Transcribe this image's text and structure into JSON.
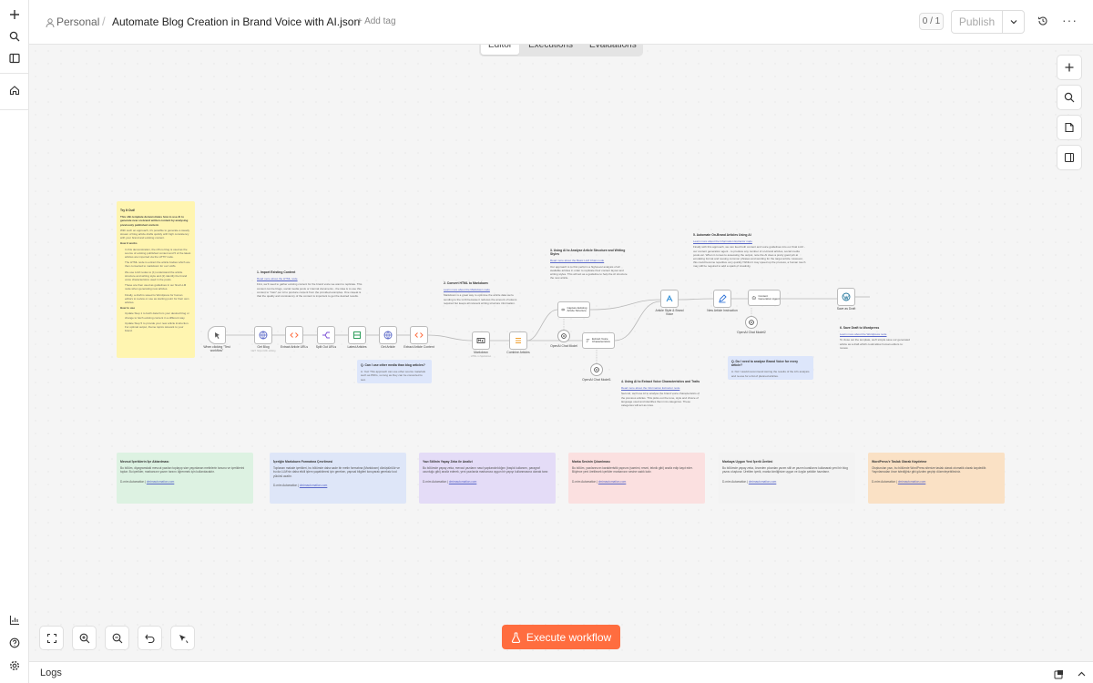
{
  "header": {
    "breadcrumb_owner": "Personal",
    "workflow_title": "Automate Blog Creation in Brand Voice with AI.json",
    "add_tag": "+ Add tag",
    "version_counter": "0 / 1",
    "publish_label": "Publish"
  },
  "tabs": [
    {
      "label": "Editor",
      "active": true
    },
    {
      "label": "Executions",
      "active": false
    },
    {
      "label": "Evaluations",
      "active": false
    }
  ],
  "sticky_notes": {
    "try_it": {
      "title": "Try It Out!",
      "lines": [
        "This n8n template demonstrates how to use AI to generate new on-brand written content by analysing previously published content.",
        "With such an approach, it's possible to generate a steady stream of blog article drafts quickly with high consistency with your brand and existing content.",
        "How it works",
        "In this demonstration, the n8n.io blog is used as the source of existing published content and 5 of the latest articles are imported via the HTTP node.",
        "The HTML node is extract the article bodies which are then converted to markdown for our LLMs.",
        "We use LLM nodes to (1) understand the article structure and writing style and (2) identify the brand voice characteristics used in the posts.",
        "These are then used as guidelines in our final LLM node when generating new articles.",
        "Finally, a draft is saved to Wordpress for human editors to review or use as starting point for their own articles.",
        "How to use",
        "Update Step 1 to fetch data from your desired blog or change to fetch existing content in a different way.",
        "Update Step 5 to provide your new article instruction. For optimal output, theme topics relevant to your brand."
      ]
    },
    "step1": {
      "title": "1. Import Existing Content",
      "link": "Read more about the HTML node",
      "body": "First, we'll need to gather existing content for the brand voice we want to replicate. This content can be blogs, social media posts or internal documents - the idea is to use this content to \"train\" our AI to produce content from the provided examples. One caveat is that the quality and consistency of the content is important to get the desired results."
    },
    "step2": {
      "title": "2. Convert HTML to Markdown",
      "link": "Learn more about the Markdown node",
      "body": "Markdown is a great way to optimise the article data we're sending to the LLM because it reduces the amount of tokens required but keeps all relevant writing structure information."
    },
    "step3": {
      "title": "3. Using AI to Analyse Article Structure and Writing Styles",
      "link": "Read more about the Basic LLM Chain node",
      "body": "Our approach is to first perform a high-level analysis of all available articles in order to replicate their content layout and writing styles. This will act as a guideline to help the AI structure the new article."
    },
    "step4": {
      "title": "4. Using AI to Extract Voice Characteristics and Traits",
      "link": "Read more about the Information Extractor node",
      "body": "Second, we'll use AI to analyse the brand voice characteristics of the previous articles. This picks out the tone, style and choice of language used and identifies them into categories. These categories will act as rules."
    },
    "step5": {
      "title": "5. Automate On-Brand Articles Using AI",
      "link": "Learn more about the Information Extractor node",
      "body": "Finally with this approach, we can feed both content and voice guidelines into our final LLM - our content generation agent - to produce any number of on-brand articles, social media posts etc. When it comes to assessing the output, note the AI does a pretty good job at emulating format and reusing common phrases and wording for the target article. However, this could become repetitive very quickly! Whilst it may speed up the process, a human touch may still be required to add a spark of creativity."
    },
    "step6": {
      "title": "6. Save Draft to Wordpress",
      "link": "Learn more about the Wordpress node",
      "body": "To close out the template, we'll simple save our generated article as a draft which could allow human editors to review."
    },
    "q1": {
      "title": "Q. Can I use other media than blog articles?",
      "body": "A. Yes! This approach can use other source materials such as PDFs, so long as they can be converted to text."
    },
    "q2": {
      "title": "Q. Do I need to analyse Brand Voice for every article?",
      "body": "A. No! I would recommend storing the results of the AI's analysis and re-use for a list of planned articles."
    }
  },
  "nodes": {
    "trigger": {
      "label": "When clicking \"Test workflow\""
    },
    "get_blog": {
      "label": "Get Blog",
      "sub": "GET: https://n8n.io/blog"
    },
    "extract_urls": {
      "label": "Extract Article URLs",
      "sub": "..."
    },
    "split_urls": {
      "label": "Split Out URLs"
    },
    "latest": {
      "label": "Latest Articles"
    },
    "get_article": {
      "label": "Get Article"
    },
    "extract_content": {
      "label": "Extract Article Content",
      "sub": "..."
    },
    "markdown": {
      "label": "Markdown",
      "sub": "HTML to Markdown"
    },
    "combine": {
      "label": "Combine Articles"
    },
    "capture_structure": {
      "label": "Capture Existing Article Structure"
    },
    "extract_voice": {
      "label": "Extract Voice Characteristics"
    },
    "model_a": {
      "label": "OpenAI Chat Model"
    },
    "model_b": {
      "label": "OpenAI Chat Model1"
    },
    "style_voice": {
      "label": "Article Style & Brand Voice"
    },
    "new_instruction": {
      "label": "New Article Instruction"
    },
    "content_gen": {
      "label": "Content Generation Agent"
    },
    "model_c": {
      "label": "OpenAI Chat Model2"
    },
    "save_draft": {
      "label": "Save as Draft"
    }
  },
  "bottom_notes": [
    {
      "title": "Mevcut İçeriklerin İçe Aktarılması",
      "body": "Bu bölüm, diyagramdaki mevcut yazıları toplayıp size yayınlanan metinlerin tonunu ve içeriklerini toplar. Bu içerikler, markanızın yazım tarzını öğrenmek için kullanılacaktır.",
      "footer": "D-mim Automation |",
      "link": "dmimautomation.com",
      "color": "#ddf2e2"
    },
    {
      "title": "İçeriğin Markdown Formatına Çevrilmesi",
      "body": "Toplanan makale içerikleri, bu bölümde daha sade bir metin formatına (Markdown) dönüştürülür ve bu da LLM'nin daha etkili işlem yapabilmesi için gereken, yapısal bilgileri koruyarak gereksiz kod yükünü azaltır.",
      "footer": "D-mim Automation |",
      "link": "dmimautomation.com",
      "color": "#dee6f8"
    },
    {
      "title": "Yazı Stilinin Yapay Zeka ile Analizi",
      "body": "Bu bölümde yapay zeka, mevcut yazıların nasıl yapılandırıldığını (başlık kullanımı, paragraf uzunluğu gibi) analiz ederek, yeni yazılarda markanıza uygun bir yapıyı kullanmasına olanak tanır.",
      "footer": "D-mim Automation |",
      "link": "dmimautomation.com",
      "color": "#e4dcf7"
    },
    {
      "title": "Marka Sesinin Çıkarılması",
      "body": "Bu bölüm, yazılarınızın karakteristik yapısını (samimi, resmi, teknik gibi) analiz edip kayıt eder. Böylece yeni üretilecek içerikler markanızın sesine sadık kalır.",
      "footer": "D-mim Automation |",
      "link": "dmimautomation.com",
      "color": "#fbe0e0"
    },
    {
      "title": "Markaya Uygun Yeni İçerik Üretimi",
      "body": "Bu bölümde yapay zeka, önceden çıkarılan yazım stili ve yazım kurallarını kullanarak yeni bir blog yazısı oluşturur. Üretilen içerik, marka kimliğinize uygun ve özgün şekilde hazırlanır.",
      "footer": "D-mim Automation |",
      "link": "dmimautomation.com",
      "color": "#f3f3f3"
    },
    {
      "title": "WordPress'e Taslak Olarak Kaydetme",
      "body": "Oluşturulan yazı, bu bölümde WordPress sitenize taslak olarak otomatik olarak kaydedilir. Yayınlamadan önce istediğiniz gibi gözden geçirip düzenleyebilirsiniz.",
      "footer": "D-mim Automation |",
      "link": "dmimautomation.com",
      "color": "#fae1c5"
    }
  ],
  "canvas": {
    "execute_label": "Execute workflow"
  },
  "footer": {
    "logs_label": "Logs"
  },
  "colors": {
    "accent": "#ff6d3f",
    "sticky_yellow": "#fff5b0",
    "sticky_blue": "#dde6fb"
  }
}
